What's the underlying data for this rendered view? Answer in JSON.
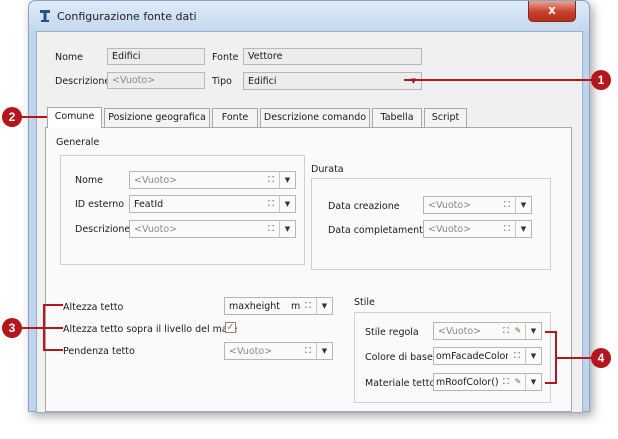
{
  "window": {
    "title": "Configurazione fonte dati",
    "close_label": "x"
  },
  "header": {
    "nome_label": "Nome",
    "nome_value": "Edifici",
    "fonte_label": "Fonte",
    "fonte_value": "Vettore",
    "descrizione_label": "Descrizione",
    "descrizione_value": "<Vuoto>",
    "tipo_label": "Tipo",
    "tipo_value": "Edifici"
  },
  "tabs": [
    {
      "label": "Comune",
      "active": true
    },
    {
      "label": "Posizione geografica"
    },
    {
      "label": "Fonte"
    },
    {
      "label": "Descrizione comando"
    },
    {
      "label": "Tabella"
    },
    {
      "label": "Script"
    }
  ],
  "generale": {
    "title": "Generale",
    "nome_label": "Nome",
    "nome_value": "<Vuoto>",
    "id_label": "ID esterno",
    "id_value": "FeatId",
    "descrizione_label": "Descrizione",
    "descrizione_value": "<Vuoto>"
  },
  "durata": {
    "title": "Durata",
    "creazione_label": "Data creazione",
    "creazione_value": "<Vuoto>",
    "completamento_label": "Data completamento",
    "completamento_value": "<Vuoto>"
  },
  "roof": {
    "altezza_label": "Altezza tetto",
    "altezza_value": "maxheight",
    "altezza_unit": "m",
    "sopra_mare_label": "Altezza tetto sopra il livello del mare",
    "sopra_mare_checked": true,
    "pendenza_label": "Pendenza tetto",
    "pendenza_value": "<Vuoto>"
  },
  "stile": {
    "title": "Stile",
    "regola_label": "Stile regola",
    "regola_value": "<Vuoto>",
    "colore_label": "Colore di base",
    "colore_value": "omFacadeColor()",
    "materiale_label": "Materiale tetto",
    "materiale_value": "mRoofColor()"
  },
  "callouts": [
    "1",
    "2",
    "3",
    "4"
  ],
  "colors": {
    "callout": "#b4161b",
    "check": "#e06a14",
    "title_bar": "#c4d8ef"
  }
}
